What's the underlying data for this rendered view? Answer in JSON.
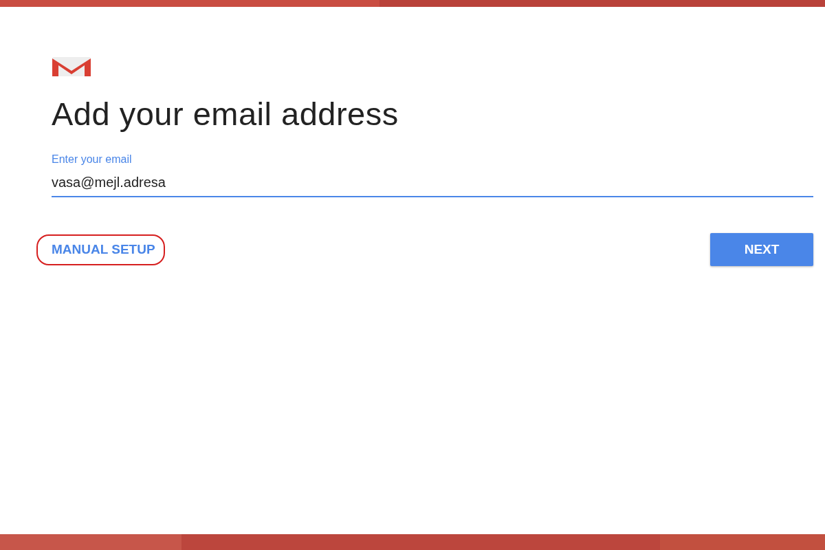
{
  "title": "Add your email address",
  "email_field": {
    "label": "Enter your email",
    "value": "vasa@mejl.adresa",
    "focused": true
  },
  "manual_setup": {
    "label": "MANUAL SETUP",
    "highlighted": true
  },
  "next_button": {
    "label": "NEXT"
  }
}
